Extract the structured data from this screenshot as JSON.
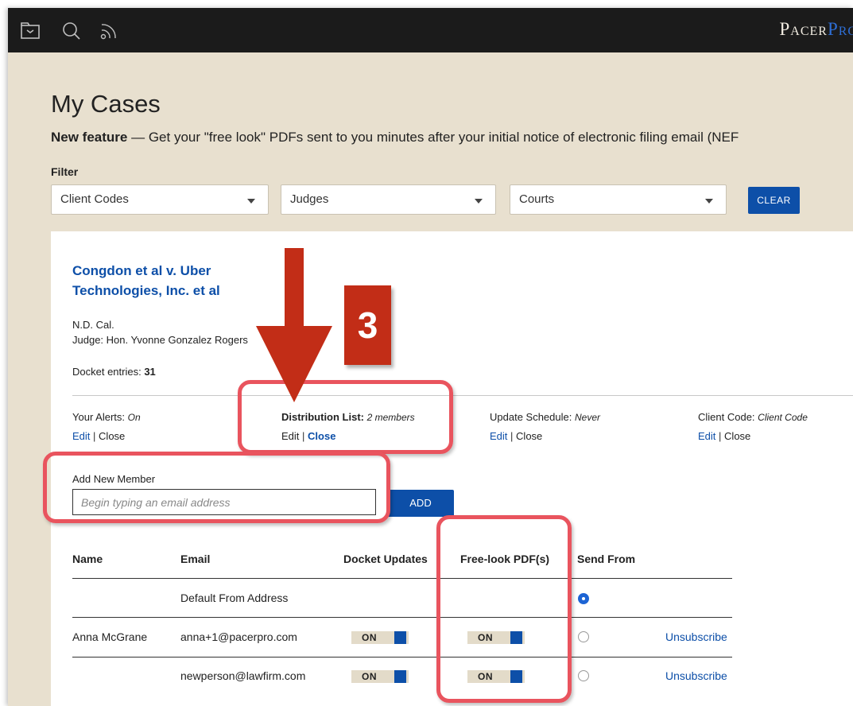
{
  "brand": {
    "part1": "Pacer",
    "part2": "Pro"
  },
  "page": {
    "title": "My Cases",
    "feature_bold": "New feature",
    "feature_text": " — Get your \"free look\" PDFs sent to you minutes after your initial notice of electronic filing email (NEF"
  },
  "filter": {
    "label": "Filter",
    "client_codes": "Client Codes",
    "judges": "Judges",
    "courts": "Courts",
    "clear": "CLEAR"
  },
  "case": {
    "title": "Congdon et al v. Uber Technologies, Inc. et al",
    "court": "N.D. Cal.",
    "judge": "Judge: Hon. Yvonne Gonzalez Rogers",
    "entries_label": "Docket entries: ",
    "entries_count": "31"
  },
  "settings": [
    {
      "label": "Your Alerts:",
      "value": "On",
      "edit": "Edit",
      "sep": "|",
      "close": "Close"
    },
    {
      "label": "Distribution List:",
      "value": "2 members",
      "edit": "Edit",
      "sep": "|",
      "close": "Close"
    },
    {
      "label": "Update Schedule:",
      "value": "Never",
      "edit": "Edit",
      "sep": "|",
      "close": "Close"
    },
    {
      "label": "Client Code:",
      "value": "Client Code",
      "edit": "Edit",
      "sep": "|",
      "close": "Close"
    }
  ],
  "add_member": {
    "label": "Add New Member",
    "placeholder": "Begin typing an email address",
    "button": "ADD"
  },
  "table": {
    "headers": [
      "Name",
      "Email",
      "Docket Updates",
      "Free-look PDF(s)",
      "Send From"
    ],
    "rows": [
      {
        "name": "",
        "email": "Default From Address",
        "docket": "",
        "freelook": "",
        "send_from": true,
        "action": ""
      },
      {
        "name": "Anna McGrane",
        "email": "anna+1@pacerpro.com",
        "docket": "ON",
        "freelook": "ON",
        "send_from": false,
        "action": "Unsubscribe"
      },
      {
        "name": "",
        "email": "newperson@lawfirm.com",
        "docket": "ON",
        "freelook": "ON",
        "send_from": false,
        "action": "Unsubscribe"
      }
    ]
  },
  "annotation": {
    "step": "3",
    "color": "#e9545e",
    "arrow_color": "#c22d17"
  },
  "colors": {
    "accent": "#0d4fa8",
    "topbar": "#1b1b1b",
    "background": "#e8e0cf"
  }
}
